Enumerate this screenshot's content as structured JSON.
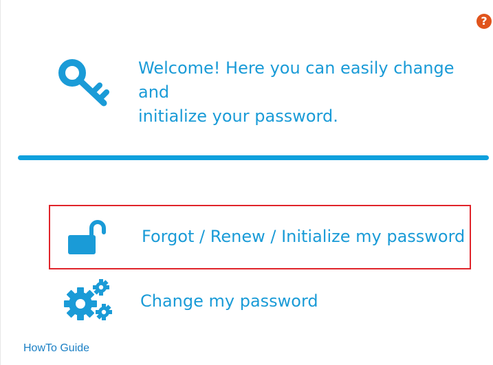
{
  "help": {
    "icon": "help-icon",
    "glyph": "?"
  },
  "welcome": {
    "icon": "key-icon",
    "text_line1": "Welcome! Here you can easily change and",
    "text_line2": "initialize your password."
  },
  "options": [
    {
      "icon": "unlock-icon",
      "label": "Forgot / Renew / Initialize my password",
      "highlighted": true
    },
    {
      "icon": "gears-icon",
      "label": "Change my password",
      "highlighted": false
    }
  ],
  "footer": {
    "howto_label": "HowTo Guide"
  },
  "colors": {
    "accent": "#1a9bd7",
    "divider": "#0ea0dd",
    "highlight_border": "#e0242a",
    "help": "#e0541c"
  }
}
